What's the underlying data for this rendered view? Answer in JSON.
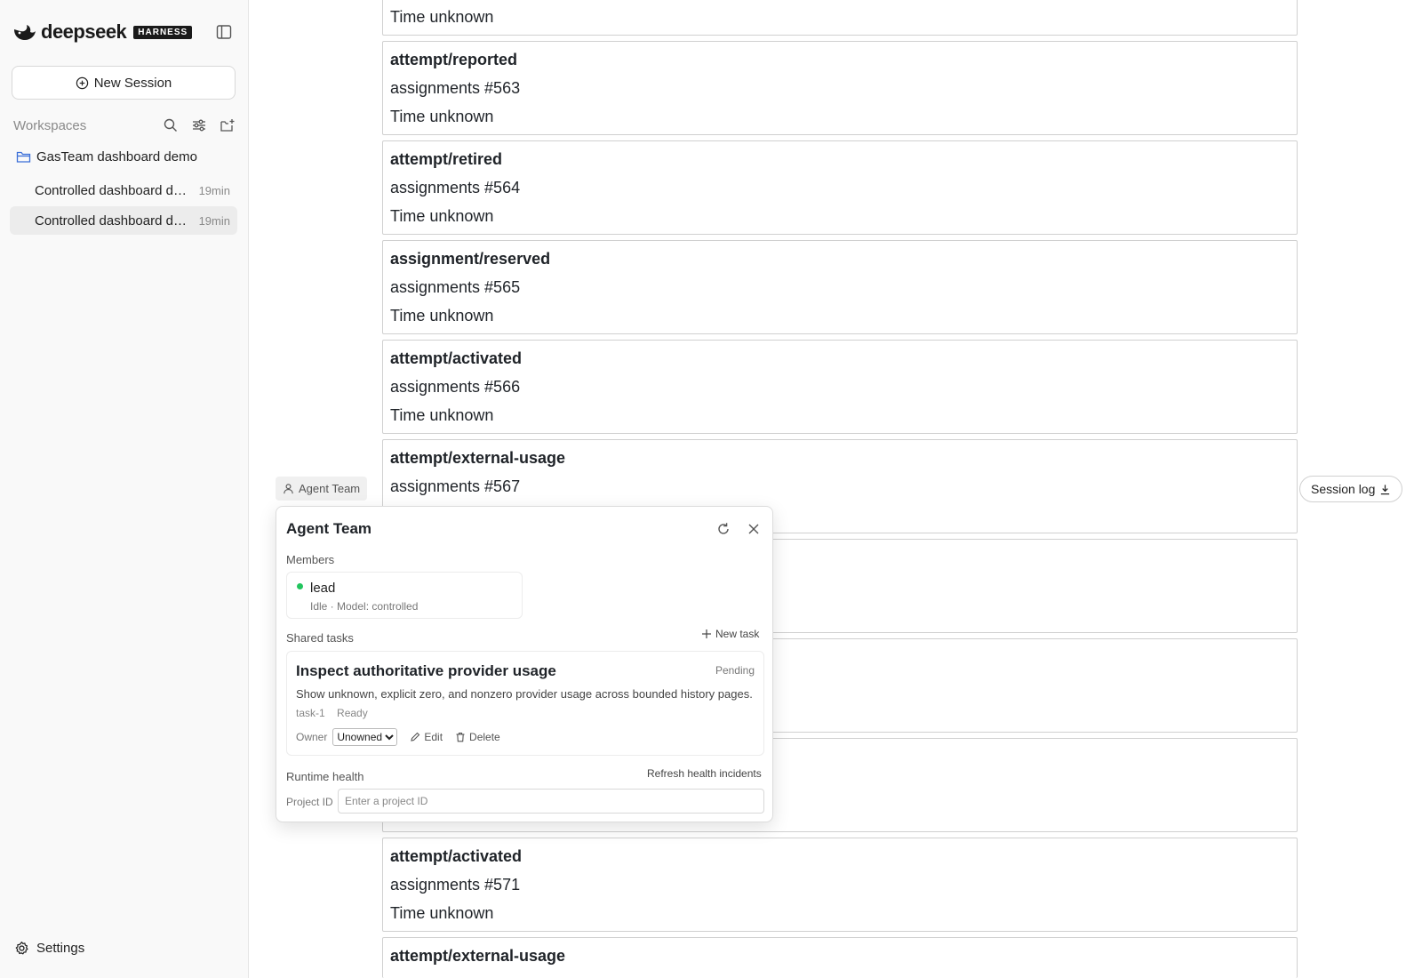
{
  "brand": {
    "wordmark": "deepseek",
    "badge": "HARNESS"
  },
  "sidebar": {
    "new_session_label": "New Session",
    "workspaces_label": "Workspaces",
    "workspace": {
      "name": "GasTeam dashboard demo"
    },
    "sessions": [
      {
        "title": "Controlled dashboard de…",
        "time": "19min"
      },
      {
        "title": "Controlled dashboard de…",
        "time": "19min"
      }
    ],
    "settings_label": "Settings"
  },
  "main": {
    "cards": [
      {
        "title": "",
        "subtitle": "",
        "time": "Time unknown"
      },
      {
        "title": "attempt/reported",
        "subtitle": "assignments #563",
        "time": "Time unknown"
      },
      {
        "title": "attempt/retired",
        "subtitle": "assignments #564",
        "time": "Time unknown"
      },
      {
        "title": "assignment/reserved",
        "subtitle": "assignments #565",
        "time": "Time unknown"
      },
      {
        "title": "attempt/activated",
        "subtitle": "assignments #566",
        "time": "Time unknown"
      },
      {
        "title": "attempt/external-usage",
        "subtitle": "assignments #567",
        "time": ""
      },
      {
        "title": "",
        "subtitle": "",
        "time": ""
      },
      {
        "title": "",
        "subtitle": "",
        "time": ""
      },
      {
        "title": "",
        "subtitle": "",
        "time": ""
      },
      {
        "title": "attempt/activated",
        "subtitle": "assignments #571",
        "time": "Time unknown"
      },
      {
        "title": "attempt/external-usage",
        "subtitle": "",
        "time": ""
      }
    ],
    "agent_team_button": "Agent Team",
    "session_log_button": "Session log"
  },
  "panel": {
    "title": "Agent Team",
    "members_label": "Members",
    "member": {
      "name": "lead",
      "status": "Idle · Model: controlled"
    },
    "shared_tasks_label": "Shared tasks",
    "new_task_label": "New task",
    "task": {
      "title": "Inspect authoritative provider usage",
      "status": "Pending",
      "description": "Show unknown, explicit zero, and nonzero provider usage across bounded history pages.",
      "id": "task-1",
      "state": "Ready",
      "owner_label": "Owner",
      "owner_value": "Unowned",
      "edit_label": "Edit",
      "delete_label": "Delete"
    },
    "runtime_health_label": "Runtime health",
    "refresh_health_label": "Refresh health incidents",
    "project_id_label": "Project ID",
    "project_id_placeholder": "Enter a project ID"
  },
  "colors": {
    "accent_green": "#22c55e",
    "folder_blue": "#3b6fd8"
  }
}
